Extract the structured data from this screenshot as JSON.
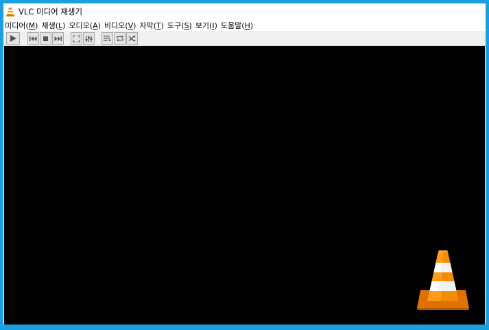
{
  "window": {
    "title": "VLC 미디어 재생기",
    "title_icon": "vlc-cone-icon"
  },
  "menu": [
    {
      "label": "미디어(",
      "key": "M",
      "suffix": ")"
    },
    {
      "label": "재생(",
      "key": "L",
      "suffix": ")"
    },
    {
      "label": "오디오(",
      "key": "A",
      "suffix": ")"
    },
    {
      "label": "비디오(",
      "key": "V",
      "suffix": ")"
    },
    {
      "label": "자막(",
      "key": "T",
      "suffix": ")"
    },
    {
      "label": "도구(",
      "key": "S",
      "suffix": ")"
    },
    {
      "label": "보기(",
      "key": "I",
      "suffix": ")"
    },
    {
      "label": "도움말(",
      "key": "H",
      "suffix": ")"
    }
  ],
  "toolbar": {
    "buttons": [
      "play-icon",
      "previous-icon",
      "stop-icon",
      "next-icon",
      "fullscreen-icon",
      "equalizer-icon",
      "playlist-icon",
      "loop-icon",
      "shuffle-icon"
    ]
  },
  "colors": {
    "desktop": "#1a9fe0",
    "video_background": "#000000",
    "cone_orange": "#f28c00",
    "toolbar": "#f0f0f0"
  },
  "video": {
    "logo": "vlc-cone-icon"
  }
}
